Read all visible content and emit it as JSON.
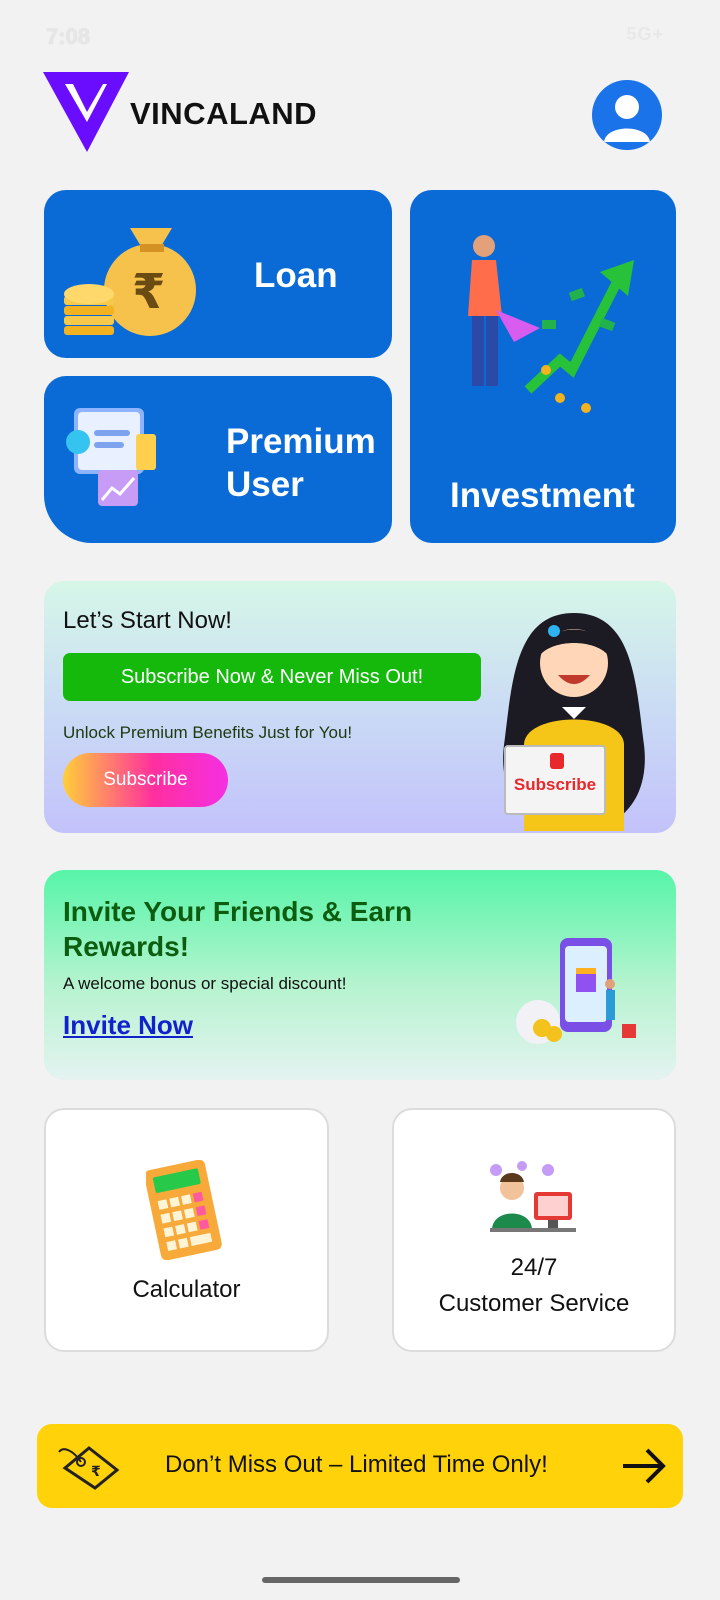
{
  "status_bar": {
    "time": "7:08",
    "network": "5G+"
  },
  "header": {
    "brand_name": "VINCALAND",
    "icons": [
      "vincaland-logo",
      "profile-avatar-icon"
    ]
  },
  "tiles": {
    "loan": "Loan",
    "premium": "Premium User",
    "investment": "Investment"
  },
  "subscribe_banner": {
    "heading": "Let’s Start Now!",
    "cta": "Subscribe Now & Never Miss Out!",
    "tagline": "Unlock Premium Benefits Just for You!",
    "button": "Subscribe",
    "sign_text": "Subscribe"
  },
  "invite": {
    "title": "Invite Your Friends & Earn Rewards!",
    "subtitle": "A welcome bonus or special discount!",
    "link": "Invite Now"
  },
  "utilities": {
    "calculator": "Calculator",
    "service_line1": "24/7",
    "service_line2": "Customer Service"
  },
  "promo": {
    "text": "Don’t Miss Out – Limited Time Only!"
  },
  "colors": {
    "primary_blue": "#0a6ad6",
    "brand_purple": "#6a0dff",
    "cta_green": "#15b90c",
    "promo_yellow": "#ffd20a",
    "invite_title_green": "#0c5d10",
    "link_blue": "#1122cc"
  }
}
